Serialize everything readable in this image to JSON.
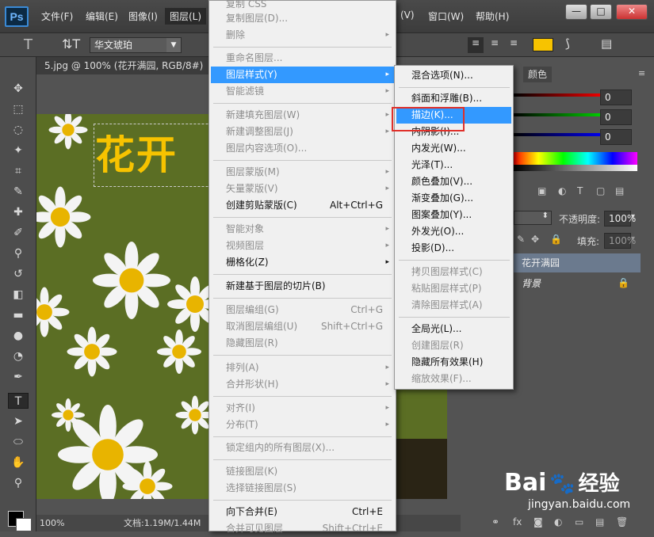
{
  "app": {
    "logo": "Ps"
  },
  "menubar": {
    "items": [
      "文件(F)",
      "编辑(E)",
      "图像(I)",
      "图层(L)",
      "(V)",
      "窗口(W)",
      "帮助(H)"
    ]
  },
  "window_controls": {
    "minimize": "—",
    "maximize": "□",
    "close": "✕"
  },
  "optionsbar": {
    "font_family": "华文琥珀"
  },
  "document_tab": {
    "title": "5.jpg @ 100% (花开满园, RGB/8#) *",
    "close": "×"
  },
  "canvas": {
    "text": "花开"
  },
  "statusbar": {
    "zoom": "100%",
    "doc_info": "文档:1.19M/1.44M"
  },
  "layer_menu": {
    "items": [
      {
        "label": "复制 CSS",
        "disabled": true
      },
      {
        "label": "复制图层(D)...",
        "disabled": true
      },
      {
        "label": "删除",
        "disabled": true,
        "arrow": "▸"
      },
      {
        "label": "重命名图层...",
        "disabled": true
      },
      {
        "label": "图层样式(Y)",
        "highlight": true,
        "arrow": "▸"
      },
      {
        "label": "智能滤镜",
        "disabled": true,
        "arrow": "▸"
      },
      {
        "label": "新建填充图层(W)",
        "disabled": true,
        "arrow": "▸"
      },
      {
        "label": "新建调整图层(J)",
        "disabled": true,
        "arrow": "▸"
      },
      {
        "label": "图层内容选项(O)...",
        "disabled": true
      },
      {
        "label": "图层蒙版(M)",
        "disabled": true,
        "arrow": "▸"
      },
      {
        "label": "矢量蒙版(V)",
        "disabled": true,
        "arrow": "▸"
      },
      {
        "label": "创建剪贴蒙版(C)",
        "shortcut": "Alt+Ctrl+G"
      },
      {
        "label": "智能对象",
        "disabled": true,
        "arrow": "▸"
      },
      {
        "label": "视频图层",
        "disabled": true,
        "arrow": "▸"
      },
      {
        "label": "栅格化(Z)",
        "arrow": "▸"
      },
      {
        "label": "新建基于图层的切片(B)"
      },
      {
        "label": "图层编组(G)",
        "disabled": true,
        "shortcut": "Ctrl+G"
      },
      {
        "label": "取消图层编组(U)",
        "disabled": true,
        "shortcut": "Shift+Ctrl+G"
      },
      {
        "label": "隐藏图层(R)",
        "disabled": true
      },
      {
        "label": "排列(A)",
        "disabled": true,
        "arrow": "▸"
      },
      {
        "label": "合并形状(H)",
        "disabled": true,
        "arrow": "▸"
      },
      {
        "label": "对齐(I)",
        "disabled": true,
        "arrow": "▸"
      },
      {
        "label": "分布(T)",
        "disabled": true,
        "arrow": "▸"
      },
      {
        "label": "锁定组内的所有图层(X)...",
        "disabled": true
      },
      {
        "label": "链接图层(K)",
        "disabled": true
      },
      {
        "label": "选择链接图层(S)",
        "disabled": true
      },
      {
        "label": "向下合并(E)",
        "shortcut": "Ctrl+E"
      },
      {
        "label": "合并可见图层",
        "disabled": true,
        "shortcut": "Shift+Ctrl+E"
      }
    ]
  },
  "style_submenu": {
    "items": [
      {
        "label": "混合选项(N)..."
      },
      {
        "label": "斜面和浮雕(B)..."
      },
      {
        "label": "描边(K)...",
        "highlight": true
      },
      {
        "label": "内阴影(I)..."
      },
      {
        "label": "内发光(W)..."
      },
      {
        "label": "光泽(T)..."
      },
      {
        "label": "颜色叠加(V)..."
      },
      {
        "label": "渐变叠加(G)..."
      },
      {
        "label": "图案叠加(Y)..."
      },
      {
        "label": "外发光(O)..."
      },
      {
        "label": "投影(D)..."
      },
      {
        "label": "拷贝图层样式(C)",
        "disabled": true
      },
      {
        "label": "粘贴图层样式(P)",
        "disabled": true
      },
      {
        "label": "清除图层样式(A)",
        "disabled": true
      },
      {
        "label": "全局光(L)..."
      },
      {
        "label": "创建图层(R)",
        "disabled": true
      },
      {
        "label": "隐藏所有效果(H)"
      },
      {
        "label": "缩放效果(F)...",
        "disabled": true
      }
    ]
  },
  "color_panel": {
    "tab": "颜色",
    "values": [
      "0",
      "0",
      "0"
    ]
  },
  "layers_panel": {
    "opacity_label": "不透明度:",
    "opacity_value": "100%",
    "fill_label": "填充:",
    "fill_value": "100%",
    "layers": [
      {
        "name": "花开满园",
        "selected": true
      },
      {
        "name": "背景",
        "locked": true
      }
    ]
  },
  "watermark": {
    "brand": "Bai",
    "brand2": "经验",
    "url": "jingyan.baidu.com"
  },
  "colors": {
    "highlight": "#3399ff",
    "text_yellow": "#f7c300",
    "callout": "#e0302a"
  }
}
